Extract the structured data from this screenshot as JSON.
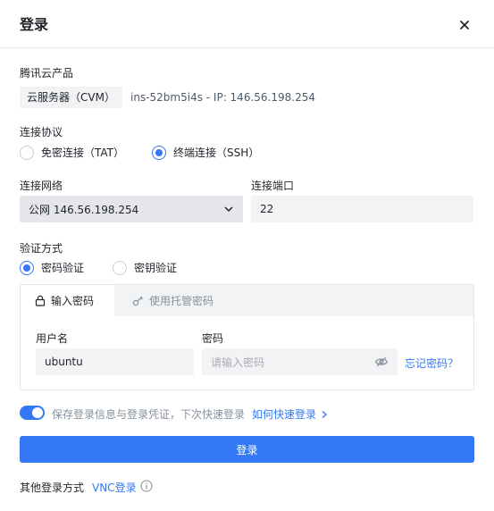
{
  "dialog": {
    "title": "登录"
  },
  "product": {
    "label": "腾讯云产品",
    "tag": "云服务器（CVM）",
    "instance": "ins-52bm5i4s - IP: 146.56.198.254"
  },
  "protocol": {
    "label": "连接协议",
    "options": [
      {
        "label": "免密连接（TAT）",
        "checked": false
      },
      {
        "label": "终端连接（SSH）",
        "checked": true
      }
    ]
  },
  "network": {
    "label": "连接网络",
    "value": "公网 146.56.198.254"
  },
  "port": {
    "label": "连接端口",
    "value": "22"
  },
  "auth": {
    "label": "验证方式",
    "options": [
      {
        "label": "密码验证",
        "checked": true
      },
      {
        "label": "密钥验证",
        "checked": false
      }
    ],
    "tabs": [
      {
        "label": "输入密码",
        "active": true
      },
      {
        "label": "使用托管密码",
        "active": false
      }
    ],
    "username_label": "用户名",
    "username_value": "ubuntu",
    "password_label": "密码",
    "password_placeholder": "请输入密码",
    "forgot_link": "忘记密码？"
  },
  "remember": {
    "enabled": true,
    "text": "保存登录信息与登录凭证，下次快速登录",
    "link": "如何快速登录"
  },
  "submit_label": "登录",
  "other": {
    "label": "其他登录方式",
    "vnc_link": "VNC登录"
  },
  "colors": {
    "accent": "#3478f6",
    "field_bg": "#f2f3f5",
    "select_bg": "#e5e6eb"
  }
}
